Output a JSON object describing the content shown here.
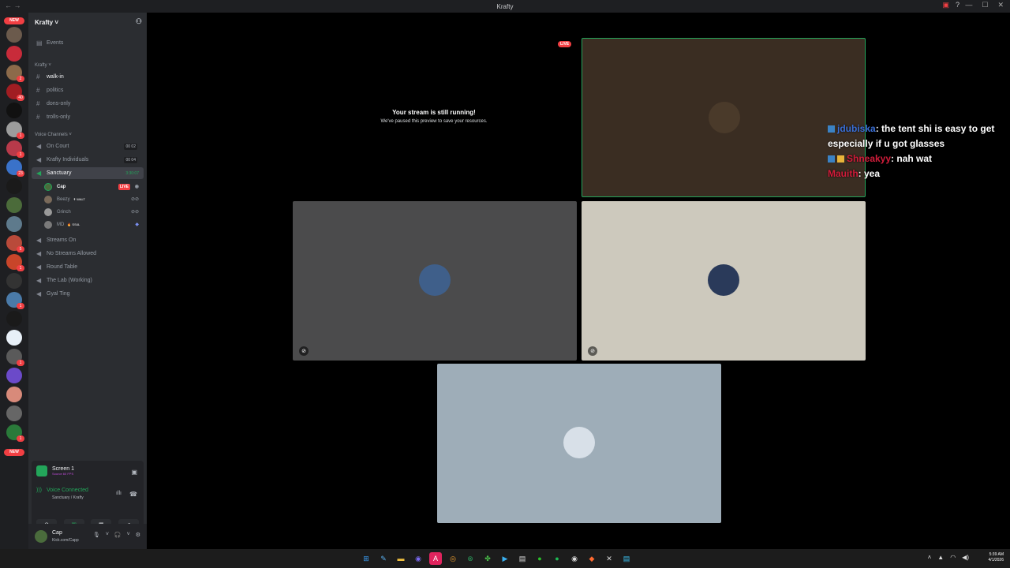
{
  "window": {
    "title": "Krafty"
  },
  "server": {
    "name": "Krafty ˅",
    "events_label": "Events",
    "category_text": "Krafty ˅",
    "text_channels": [
      "walk-in",
      "politics",
      "dons-only",
      "trolls-only"
    ],
    "voice_category": "Voice Channels ˅",
    "voice_channels": [
      {
        "name": "On Court",
        "count": "00 02"
      },
      {
        "name": "Krafty Individuals",
        "count": "00 04"
      },
      {
        "name": "Sanctuary",
        "timer": "3:30:07"
      }
    ],
    "voice_users": [
      {
        "name": "Cap",
        "live": "LIVE"
      },
      {
        "name": "Beezy",
        "tag": "✝ WALT"
      },
      {
        "name": "Grinch"
      },
      {
        "name": "MD",
        "tag": "🔥 SS4L"
      }
    ],
    "more_voice_channels": [
      "Streams On",
      "No Streams Allowed",
      "Round Table",
      "The Lab (Working)",
      "Gyal Ting"
    ]
  },
  "guilds": {
    "new_label": "NEW",
    "badges": [
      "2",
      "40",
      "76",
      "1",
      "1",
      "23",
      "5",
      "1",
      "1",
      "1",
      "1",
      "1",
      "1"
    ]
  },
  "stream_panel": {
    "screen_label": "Screen 1",
    "screen_sub": "Source 60 FPS",
    "voice_connected": "Voice Connected",
    "voice_location": "Sanctuary / Krafty"
  },
  "user": {
    "name": "Cap",
    "status": "Kick.com/Capp"
  },
  "stage": {
    "paused_title": "Your stream is still running!",
    "paused_sub": "We've paused this preview to save your resources.",
    "live_badge": "LIVE"
  },
  "chat": [
    {
      "user": "jdubiska",
      "text": ": the tent shi is easy to get especially if u got glasses"
    },
    {
      "user": "Shneakyy",
      "text": ": nah wat"
    },
    {
      "user": "Mauith",
      "text": ": yea"
    }
  ],
  "taskbar": {
    "time": "5:39 AM",
    "date": "4/1/2026"
  },
  "colors": {
    "green": "#23a55a",
    "red": "#f23f43",
    "sidebar": "#2b2d31"
  }
}
